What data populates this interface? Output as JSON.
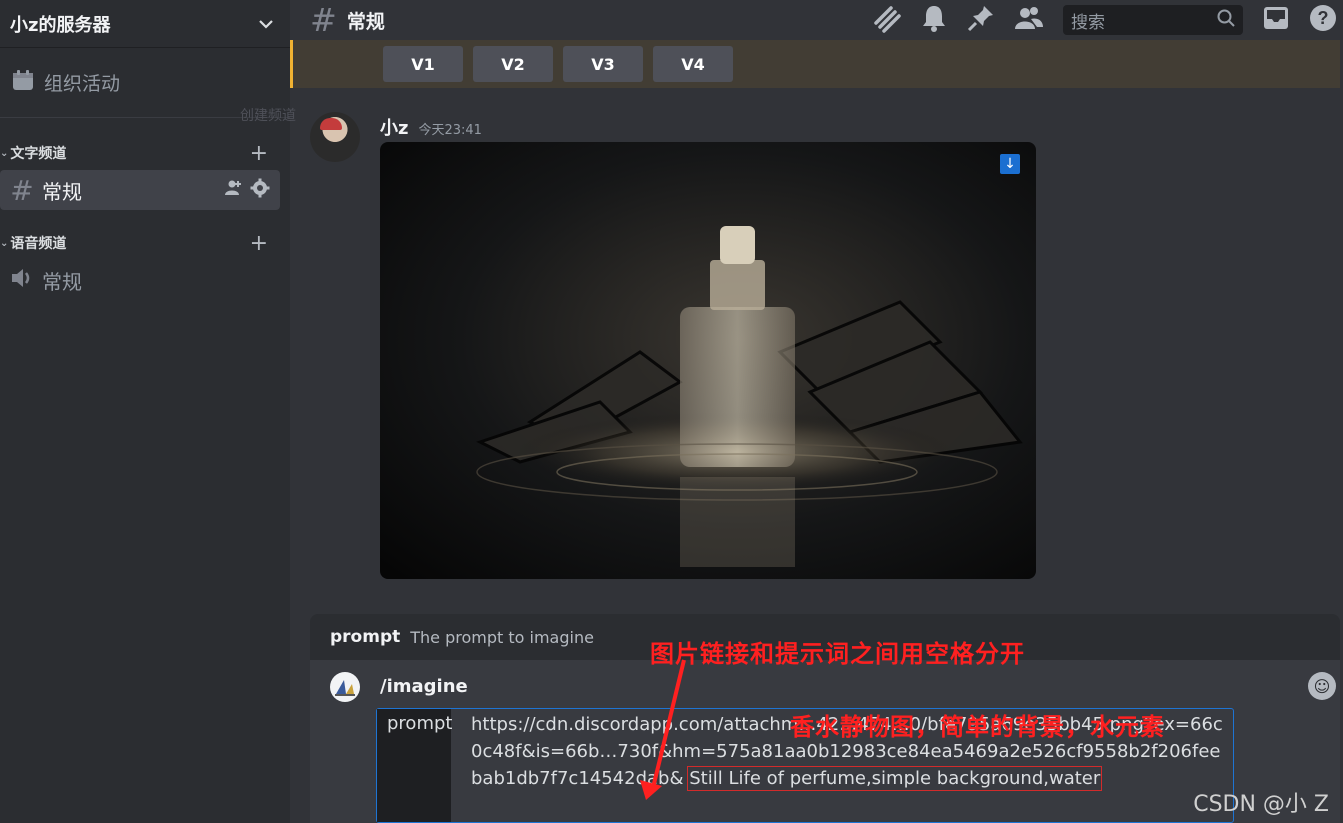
{
  "sidebar": {
    "server_name": "小z的服务器",
    "events_label": "组织活动",
    "ghost_text": "创建频道",
    "text_category": "文字频道",
    "text_channel": "常规",
    "voice_category": "语音频道",
    "voice_channel": "常规"
  },
  "topbar": {
    "channel_name": "常规",
    "search_placeholder": "搜索"
  },
  "variation_buttons": [
    "V1",
    "V2",
    "V3",
    "V4"
  ],
  "message": {
    "author": "小z",
    "timestamp": "今天23:41",
    "download_icon": "↓"
  },
  "command_panel": {
    "option_key": "prompt",
    "option_desc": "The prompt to imagine",
    "command": "/imagine",
    "field_label": "prompt",
    "field_value_url": "https://cdn.discordapp.com/attachm…42…474…0/bfe795a69e35bb45.png?ex=66c0c48f&is=66b…730f&hm=575a81aa0b12983ce84ea5469a2e526cf9558b2f206feebab1db7f7c14542dab&",
    "field_value_prompt": "Still Life of perfume,simple background,water"
  },
  "annotations": {
    "separator_note": "图片链接和提示词之间用空格分开",
    "prompt_note": "香水静物图，简单的背景，水元素",
    "watermark": "CSDN @小 Z"
  },
  "colors": {
    "accent_blue": "#1e74d3",
    "annotation_red": "#ff2020",
    "banner_border": "#f0b232"
  }
}
